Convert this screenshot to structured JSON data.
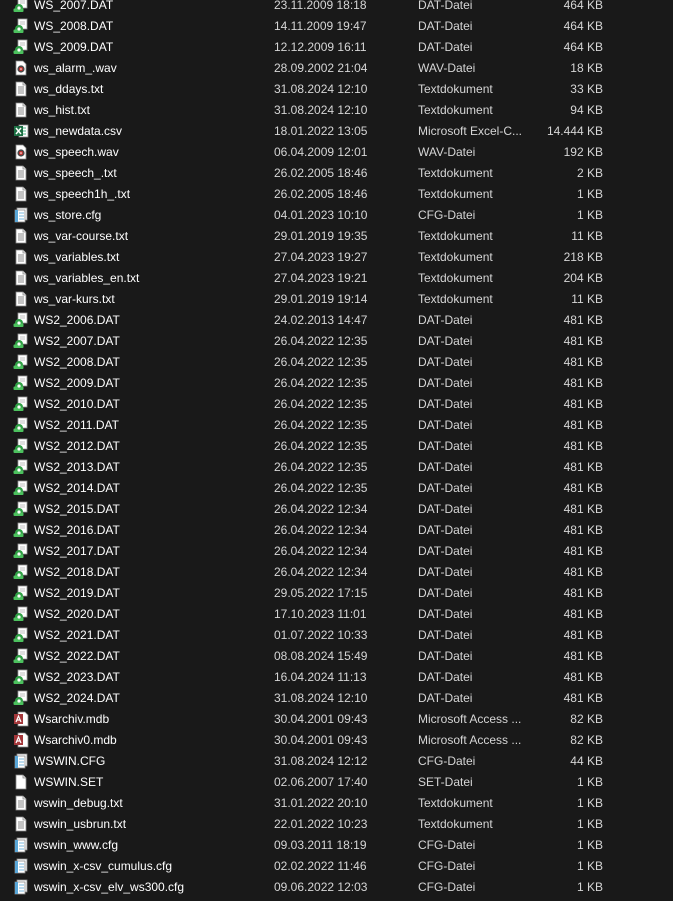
{
  "files": [
    {
      "name": "WS_2007.DAT",
      "date": "23.11.2009 18:18",
      "type": "DAT-Datei",
      "size": "464 KB",
      "icon": "dat-file-icon"
    },
    {
      "name": "WS_2008.DAT",
      "date": "14.11.2009 19:47",
      "type": "DAT-Datei",
      "size": "464 KB",
      "icon": "dat-file-icon"
    },
    {
      "name": "WS_2009.DAT",
      "date": "12.12.2009 16:11",
      "type": "DAT-Datei",
      "size": "464 KB",
      "icon": "dat-file-icon"
    },
    {
      "name": "ws_alarm_.wav",
      "date": "28.09.2002 21:04",
      "type": "WAV-Datei",
      "size": "18 KB",
      "icon": "wav-file-icon"
    },
    {
      "name": "ws_ddays.txt",
      "date": "31.08.2024 12:10",
      "type": "Textdokument",
      "size": "33 KB",
      "icon": "txt-file-icon"
    },
    {
      "name": "ws_hist.txt",
      "date": "31.08.2024 12:10",
      "type": "Textdokument",
      "size": "94 KB",
      "icon": "txt-file-icon"
    },
    {
      "name": "ws_newdata.csv",
      "date": "18.01.2022 13:05",
      "type": "Microsoft Excel-C...",
      "size": "14.444 KB",
      "icon": "excel-file-icon"
    },
    {
      "name": "ws_speech.wav",
      "date": "06.04.2009 12:01",
      "type": "WAV-Datei",
      "size": "192 KB",
      "icon": "wav-file-icon"
    },
    {
      "name": "ws_speech_.txt",
      "date": "26.02.2005 18:46",
      "type": "Textdokument",
      "size": "2 KB",
      "icon": "txt-file-icon"
    },
    {
      "name": "ws_speech1h_.txt",
      "date": "26.02.2005 18:46",
      "type": "Textdokument",
      "size": "1 KB",
      "icon": "txt-file-icon"
    },
    {
      "name": "ws_store.cfg",
      "date": "04.01.2023 10:10",
      "type": "CFG-Datei",
      "size": "1 KB",
      "icon": "cfg-file-icon"
    },
    {
      "name": "ws_var-course.txt",
      "date": "29.01.2019 19:35",
      "type": "Textdokument",
      "size": "11 KB",
      "icon": "txt-file-icon"
    },
    {
      "name": "ws_variables.txt",
      "date": "27.04.2023 19:27",
      "type": "Textdokument",
      "size": "218 KB",
      "icon": "txt-file-icon"
    },
    {
      "name": "ws_variables_en.txt",
      "date": "27.04.2023 19:21",
      "type": "Textdokument",
      "size": "204 KB",
      "icon": "txt-file-icon"
    },
    {
      "name": "ws_var-kurs.txt",
      "date": "29.01.2019 19:14",
      "type": "Textdokument",
      "size": "11 KB",
      "icon": "txt-file-icon"
    },
    {
      "name": "WS2_2006.DAT",
      "date": "24.02.2013 14:47",
      "type": "DAT-Datei",
      "size": "481 KB",
      "icon": "dat-file-icon"
    },
    {
      "name": "WS2_2007.DAT",
      "date": "26.04.2022 12:35",
      "type": "DAT-Datei",
      "size": "481 KB",
      "icon": "dat-file-icon"
    },
    {
      "name": "WS2_2008.DAT",
      "date": "26.04.2022 12:35",
      "type": "DAT-Datei",
      "size": "481 KB",
      "icon": "dat-file-icon"
    },
    {
      "name": "WS2_2009.DAT",
      "date": "26.04.2022 12:35",
      "type": "DAT-Datei",
      "size": "481 KB",
      "icon": "dat-file-icon"
    },
    {
      "name": "WS2_2010.DAT",
      "date": "26.04.2022 12:35",
      "type": "DAT-Datei",
      "size": "481 KB",
      "icon": "dat-file-icon"
    },
    {
      "name": "WS2_2011.DAT",
      "date": "26.04.2022 12:35",
      "type": "DAT-Datei",
      "size": "481 KB",
      "icon": "dat-file-icon"
    },
    {
      "name": "WS2_2012.DAT",
      "date": "26.04.2022 12:35",
      "type": "DAT-Datei",
      "size": "481 KB",
      "icon": "dat-file-icon"
    },
    {
      "name": "WS2_2013.DAT",
      "date": "26.04.2022 12:35",
      "type": "DAT-Datei",
      "size": "481 KB",
      "icon": "dat-file-icon"
    },
    {
      "name": "WS2_2014.DAT",
      "date": "26.04.2022 12:35",
      "type": "DAT-Datei",
      "size": "481 KB",
      "icon": "dat-file-icon"
    },
    {
      "name": "WS2_2015.DAT",
      "date": "26.04.2022 12:34",
      "type": "DAT-Datei",
      "size": "481 KB",
      "icon": "dat-file-icon"
    },
    {
      "name": "WS2_2016.DAT",
      "date": "26.04.2022 12:34",
      "type": "DAT-Datei",
      "size": "481 KB",
      "icon": "dat-file-icon"
    },
    {
      "name": "WS2_2017.DAT",
      "date": "26.04.2022 12:34",
      "type": "DAT-Datei",
      "size": "481 KB",
      "icon": "dat-file-icon"
    },
    {
      "name": "WS2_2018.DAT",
      "date": "26.04.2022 12:34",
      "type": "DAT-Datei",
      "size": "481 KB",
      "icon": "dat-file-icon"
    },
    {
      "name": "WS2_2019.DAT",
      "date": "29.05.2022 17:15",
      "type": "DAT-Datei",
      "size": "481 KB",
      "icon": "dat-file-icon"
    },
    {
      "name": "WS2_2020.DAT",
      "date": "17.10.2023 11:01",
      "type": "DAT-Datei",
      "size": "481 KB",
      "icon": "dat-file-icon"
    },
    {
      "name": "WS2_2021.DAT",
      "date": "01.07.2022 10:33",
      "type": "DAT-Datei",
      "size": "481 KB",
      "icon": "dat-file-icon"
    },
    {
      "name": "WS2_2022.DAT",
      "date": "08.08.2024 15:49",
      "type": "DAT-Datei",
      "size": "481 KB",
      "icon": "dat-file-icon"
    },
    {
      "name": "WS2_2023.DAT",
      "date": "16.04.2024 11:13",
      "type": "DAT-Datei",
      "size": "481 KB",
      "icon": "dat-file-icon"
    },
    {
      "name": "WS2_2024.DAT",
      "date": "31.08.2024 12:10",
      "type": "DAT-Datei",
      "size": "481 KB",
      "icon": "dat-file-icon"
    },
    {
      "name": "Wsarchiv.mdb",
      "date": "30.04.2001 09:43",
      "type": "Microsoft Access ...",
      "size": "82 KB",
      "icon": "access-file-icon"
    },
    {
      "name": "Wsarchiv0.mdb",
      "date": "30.04.2001 09:43",
      "type": "Microsoft Access ...",
      "size": "82 KB",
      "icon": "access-file-icon"
    },
    {
      "name": "WSWIN.CFG",
      "date": "31.08.2024 12:12",
      "type": "CFG-Datei",
      "size": "44 KB",
      "icon": "cfg-file-icon"
    },
    {
      "name": "WSWIN.SET",
      "date": "02.06.2007 17:40",
      "type": "SET-Datei",
      "size": "1 KB",
      "icon": "blank-file-icon"
    },
    {
      "name": "wswin_debug.txt",
      "date": "31.01.2022 20:10",
      "type": "Textdokument",
      "size": "1 KB",
      "icon": "txt-file-icon"
    },
    {
      "name": "wswin_usbrun.txt",
      "date": "22.01.2022 10:23",
      "type": "Textdokument",
      "size": "1 KB",
      "icon": "txt-file-icon"
    },
    {
      "name": "wswin_www.cfg",
      "date": "09.03.2011 18:19",
      "type": "CFG-Datei",
      "size": "1 KB",
      "icon": "cfg-file-icon"
    },
    {
      "name": "wswin_x-csv_cumulus.cfg",
      "date": "02.02.2022 11:46",
      "type": "CFG-Datei",
      "size": "1 KB",
      "icon": "cfg-file-icon"
    },
    {
      "name": "wswin_x-csv_elv_ws300.cfg",
      "date": "09.06.2022 12:03",
      "type": "CFG-Datei",
      "size": "1 KB",
      "icon": "cfg-file-icon"
    }
  ]
}
